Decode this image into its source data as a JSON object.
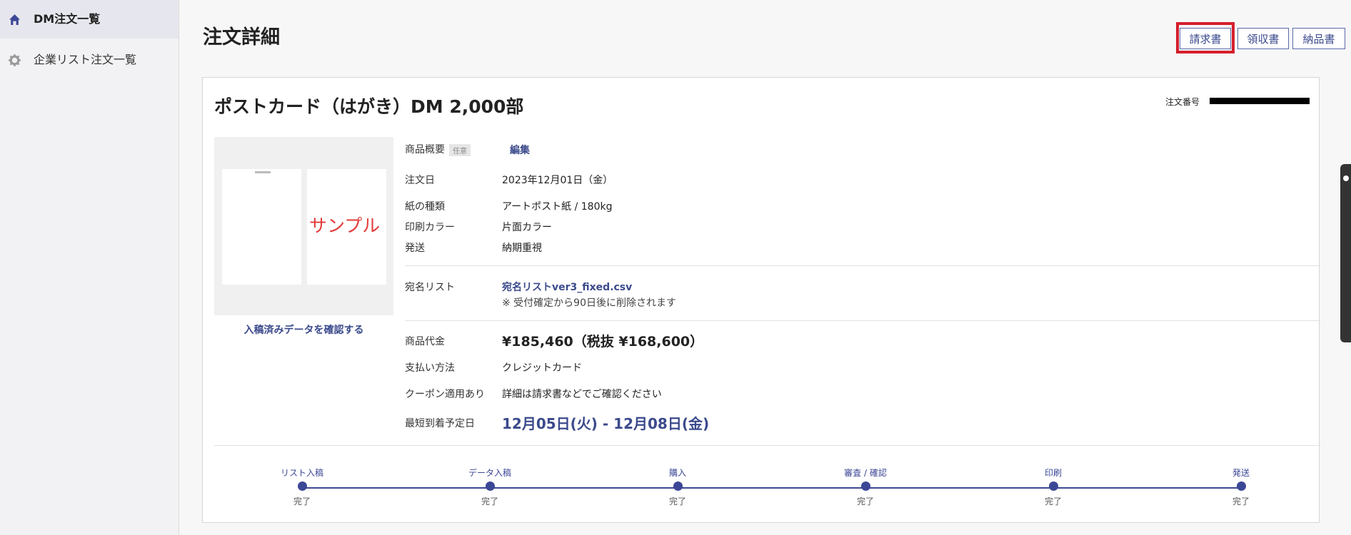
{
  "sidebar": {
    "items": [
      {
        "label": "DM注文一覧",
        "icon": "home-icon",
        "active": true
      },
      {
        "label": "企業リスト注文一覧",
        "icon": "gear-icon",
        "active": false
      }
    ]
  },
  "header": {
    "title": "注文詳細",
    "buttons": {
      "invoice": "請求書",
      "receipt": "領収書",
      "delivery_note": "納品書"
    }
  },
  "order": {
    "product_title": "ポストカード（はがき）DM  2,000部",
    "order_number_label": "注文番号",
    "preview_text": "サンプル",
    "check_link": "入稿済みデータを確認する",
    "summary_label": "商品概要",
    "summary_badge": "任意",
    "edit_link": "編集",
    "date_label": "注文日",
    "date_value": "2023年12月01日（金）",
    "paper_label": "紙の種類",
    "paper_value": "アートポスト紙 / 180kg",
    "color_label": "印刷カラー",
    "color_value": "片面カラー",
    "shipping_label": "発送",
    "shipping_value": "納期重視",
    "list_label": "宛名リスト",
    "list_file": "宛名リストver3_fixed.csv",
    "list_note": "※ 受付確定から90日後に削除されます",
    "price_label": "商品代金",
    "price_value": "¥185,460（税抜 ¥168,600）",
    "payment_label": "支払い方法",
    "payment_value": "クレジットカード",
    "coupon_label": "クーポン適用あり",
    "coupon_value": "詳細は請求書などでご確認ください",
    "arrival_label": "最短到着予定日",
    "arrival_value": "12月05日(火) - 12月08日(金)"
  },
  "progress": {
    "steps": [
      {
        "label": "リスト入稿",
        "status": "完了"
      },
      {
        "label": "データ入稿",
        "status": "完了"
      },
      {
        "label": "購入",
        "status": "完了"
      },
      {
        "label": "審査 / 確認",
        "status": "完了"
      },
      {
        "label": "印刷",
        "status": "完了"
      },
      {
        "label": "発送",
        "status": "完了"
      }
    ]
  },
  "colors": {
    "accent": "#3c4796",
    "highlight": "#d51f2d",
    "sample": "#e33a3a"
  }
}
